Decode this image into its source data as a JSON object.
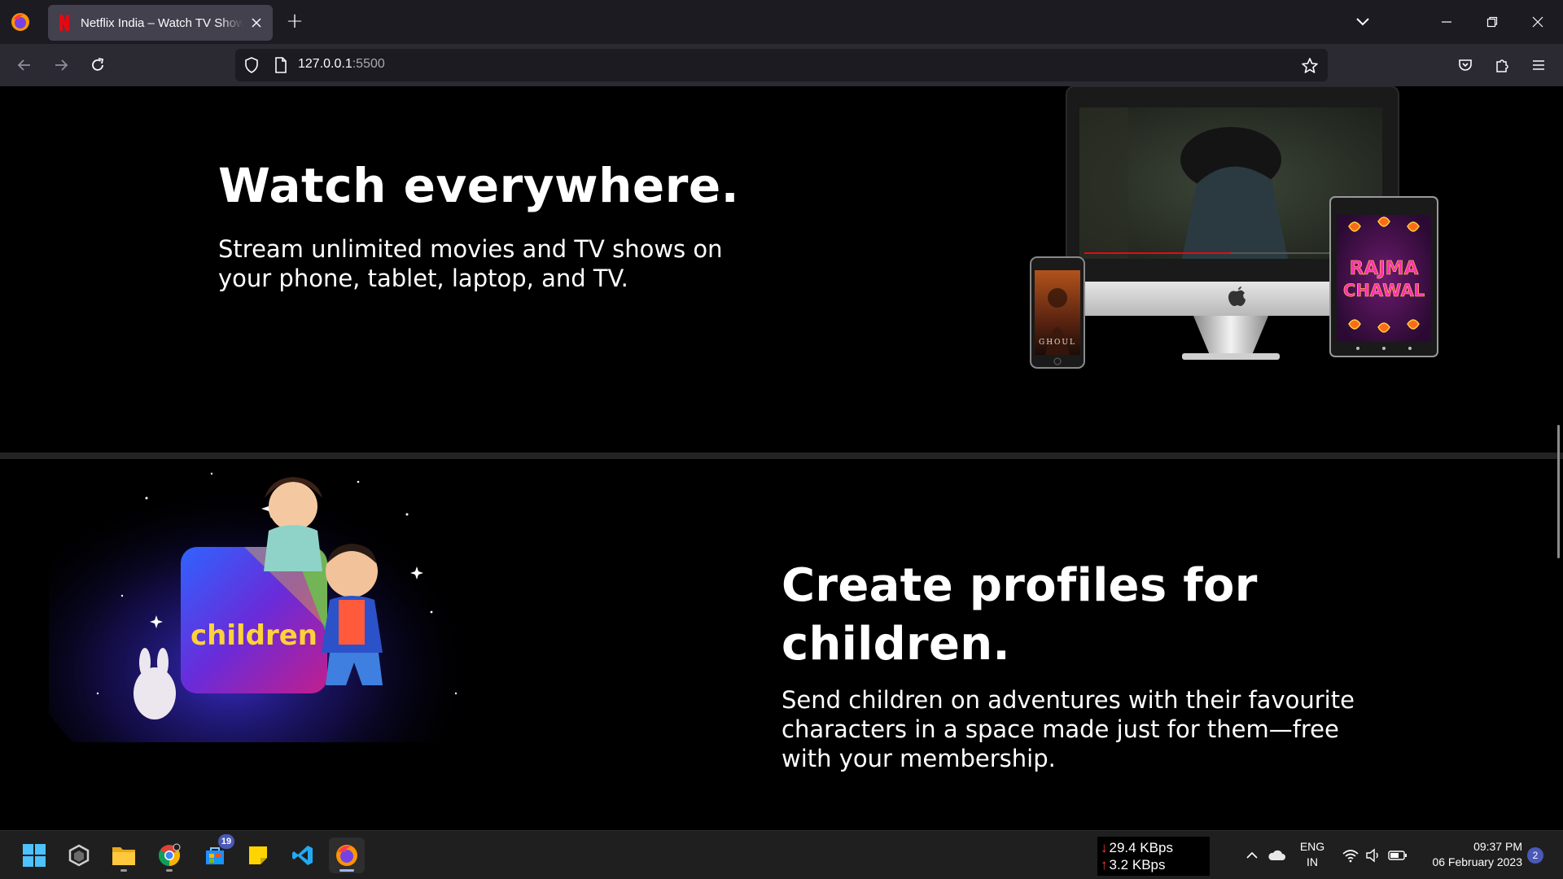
{
  "browser": {
    "tab_title": "Netflix India – Watch TV Shows Online",
    "tab_close_icon": "close-icon",
    "new_tab_symbol": "+",
    "url_host": "127.0.0.1",
    "url_port": ":5500"
  },
  "page": {
    "section1": {
      "title": "Watch everywhere.",
      "description": "Stream unlimited movies and TV shows on your phone, tablet, laptop, and TV.",
      "phone_poster_title": "GHOUL",
      "tablet_poster_title_line1": "RAJMA",
      "tablet_poster_title_line2": "CHAWAL"
    },
    "section2": {
      "title": "Create profiles for children.",
      "description": "Send children on adventures with their favourite characters in a space made just for them—free with your membership.",
      "art_label": "children"
    }
  },
  "taskbar": {
    "store_badge": "19",
    "net_down": "29.4 KBps",
    "net_up": "3.2 KBps",
    "net_down_arrow": "↓",
    "net_up_arrow": "↑",
    "lang_line1": "ENG",
    "lang_line2": "IN",
    "time": "09:37 PM",
    "date": "06 February 2023",
    "notification_count": "2"
  },
  "colors": {
    "netflix_red": "#e50914",
    "tab_bg": "#42414d",
    "toolbar_bg": "#2b2a33",
    "page_bg": "#000000",
    "taskbar_bg": "#1f1f1f"
  }
}
